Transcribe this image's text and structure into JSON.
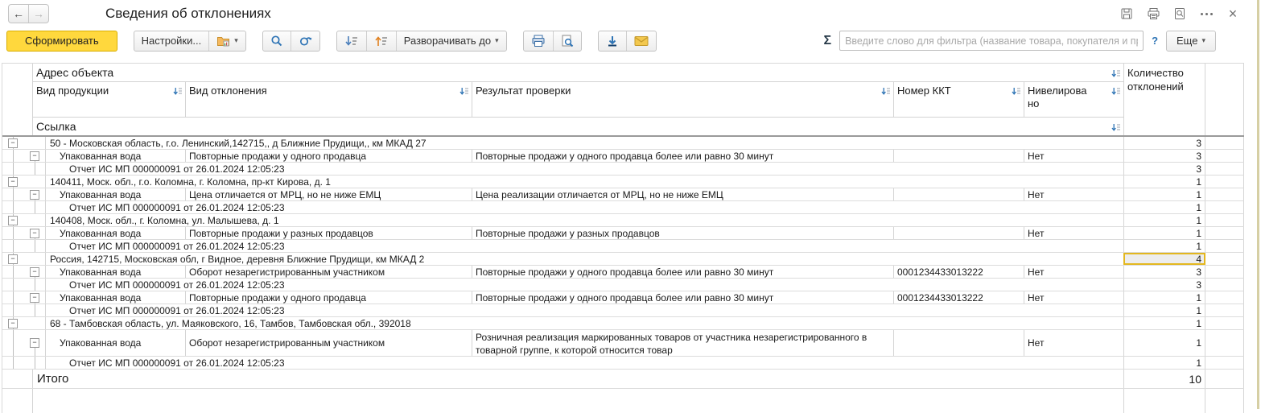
{
  "window": {
    "title": "Сведения об отклонениях",
    "back_icon": "←",
    "forward_icon": "→",
    "close_icon": "×",
    "icons": [
      "save-icon",
      "print-icon",
      "preview-icon",
      "menu-icon",
      "close-icon"
    ]
  },
  "toolbar": {
    "generate_label": "Сформировать",
    "settings_label": "Настройки...",
    "expand_to_label": "Разворачивать до",
    "caret": "▾",
    "sum_symbol": "Σ",
    "filter_placeholder": "Введите слово для фильтра (название товара, покупателя и пр.)",
    "help_label": "?",
    "more_label": "Еще",
    "icons": [
      "report-variants-icon",
      "search-icon",
      "refresh-search-icon",
      "sort-descending-icon",
      "sort-ascending-icon",
      "print-icon",
      "print-preview-icon",
      "download-icon",
      "email-icon"
    ]
  },
  "colors": {
    "generate_button": "#ffd83d",
    "selected_cell_border": "#e3b71f",
    "icon_blue": "#2e74b5"
  },
  "table": {
    "collapse_glyph": "−",
    "headers": {
      "address": "Адрес объекта",
      "product": "Вид продукции",
      "deviation": "Вид отклонения",
      "result": "Результат проверки",
      "kkt": "Номер ККТ",
      "leveled": "Нивелировано",
      "count": "Количество отклонений",
      "link": "Ссылка"
    },
    "rows": [
      {
        "t": "g",
        "text": "50 - Московская область, г.о. Ленинский,142715,, д Ближние Прудищи,, км МКАД 27",
        "n": "3"
      },
      {
        "t": "d",
        "product": "Упакованная вода",
        "dev": "Повторные продажи у одного продавца",
        "res": "Повторные продажи у одного продавца более или равно 30 минут",
        "kkt": "",
        "lev": "Нет",
        "n": "3"
      },
      {
        "t": "r",
        "text": "Отчет ИС МП 000000091 от 26.01.2024 12:05:23",
        "n": "3"
      },
      {
        "t": "g",
        "text": "140411, Моск. обл., г.о. Коломна, г. Коломна, пр-кт Кирова, д. 1",
        "n": "1"
      },
      {
        "t": "d",
        "product": "Упакованная вода",
        "dev": "Цена отличается от МРЦ, но не ниже ЕМЦ",
        "res": "Цена реализации отличается от МРЦ, но не ниже ЕМЦ",
        "kkt": "",
        "lev": "Нет",
        "n": "1"
      },
      {
        "t": "r",
        "text": "Отчет ИС МП 000000091 от 26.01.2024 12:05:23",
        "n": "1"
      },
      {
        "t": "g",
        "text": "140408, Моск. обл., г. Коломна, ул. Малышева, д. 1",
        "n": "1"
      },
      {
        "t": "d",
        "product": "Упакованная вода",
        "dev": "Повторные продажи у разных продавцов",
        "res": "Повторные продажи у разных продавцов",
        "kkt": "",
        "lev": "Нет",
        "n": "1"
      },
      {
        "t": "r",
        "text": "Отчет ИС МП 000000091 от 26.01.2024 12:05:23",
        "n": "1"
      },
      {
        "t": "g",
        "text": "Россия, 142715, Московская обл, г Видное, деревня Ближние Прудищи, км МКАД 2",
        "n": "4",
        "sel": true
      },
      {
        "t": "d",
        "product": "Упакованная вода",
        "dev": "Оборот незарегистрированным участником",
        "res": "Повторные продажи у одного продавца более или равно 30 минут",
        "kkt": "0001234433013222",
        "lev": "Нет",
        "n": "3"
      },
      {
        "t": "r",
        "text": "Отчет ИС МП 000000091 от 26.01.2024 12:05:23",
        "n": "3"
      },
      {
        "t": "d",
        "product": "Упакованная вода",
        "dev": "Повторные продажи у одного продавца",
        "res": "Повторные продажи у одного продавца более или равно 30 минут",
        "kkt": "0001234433013222",
        "lev": "Нет",
        "n": "1"
      },
      {
        "t": "r",
        "text": "Отчет ИС МП 000000091 от 26.01.2024 12:05:23",
        "n": "1"
      },
      {
        "t": "g",
        "text": "68 - Тамбовская область, ул. Маяковского, 16, Тамбов, Тамбовская обл., 392018",
        "n": "1"
      },
      {
        "t": "d",
        "product": "Упакованная вода",
        "dev": "Оборот незарегистрированным участником",
        "res": "Розничная реализация маркированных товаров от участника незарегистрированного в товарной группе, к которой относится товар",
        "kkt": "",
        "lev": "Нет",
        "n": "1",
        "tall": true
      },
      {
        "t": "r",
        "text": "Отчет ИС МП 000000091 от 26.01.2024 12:05:23",
        "n": "1"
      },
      {
        "t": "T",
        "text": "Итого",
        "n": "10"
      }
    ]
  }
}
